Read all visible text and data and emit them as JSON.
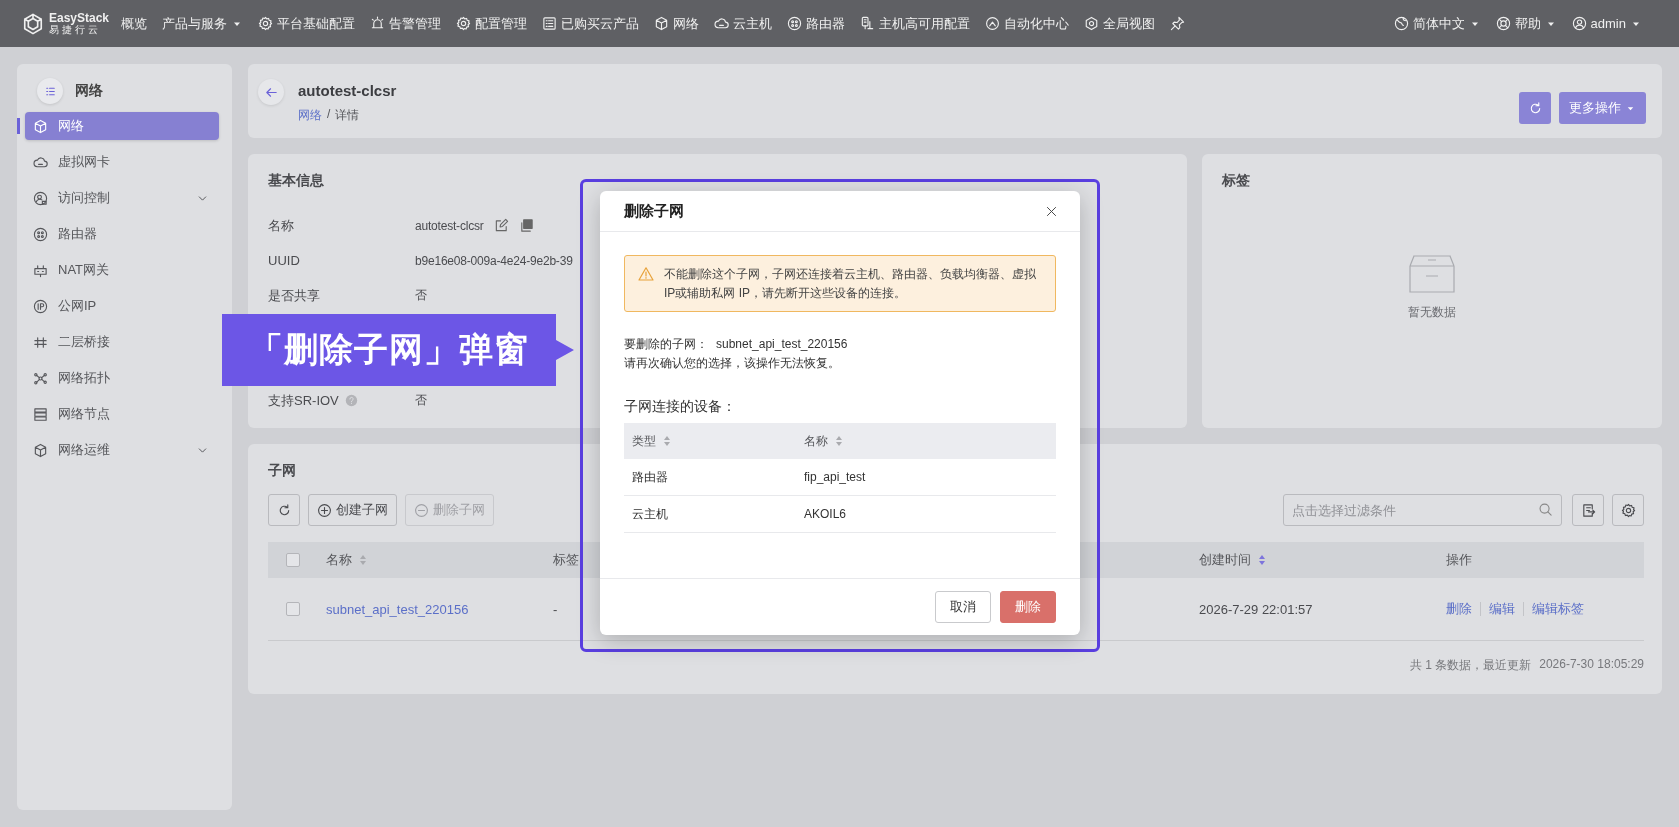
{
  "top_nav": {
    "logo": {
      "name": "EasyStack",
      "tagline": "易捷行云"
    },
    "items": [
      {
        "label": "概览",
        "dropdown": false
      },
      {
        "label": "产品与服务",
        "dropdown": true
      },
      {
        "label": "平台基础配置",
        "dropdown": false
      },
      {
        "label": "告警管理",
        "dropdown": false
      },
      {
        "label": "配置管理",
        "dropdown": false
      },
      {
        "label": "已购买云产品",
        "dropdown": false
      },
      {
        "label": "网络",
        "dropdown": false
      },
      {
        "label": "云主机",
        "dropdown": false
      },
      {
        "label": "路由器",
        "dropdown": false
      },
      {
        "label": "主机高可用配置",
        "dropdown": false
      },
      {
        "label": "自动化中心",
        "dropdown": false
      },
      {
        "label": "全局视图",
        "dropdown": false
      }
    ],
    "right": [
      {
        "label": "简体中文",
        "dropdown": true
      },
      {
        "label": "帮助",
        "dropdown": true
      },
      {
        "label": "admin",
        "dropdown": true
      }
    ]
  },
  "sidebar": {
    "title": "网络",
    "items": [
      {
        "label": "网络",
        "selected": true,
        "expandable": false
      },
      {
        "label": "虚拟网卡",
        "selected": false,
        "expandable": false
      },
      {
        "label": "访问控制",
        "selected": false,
        "expandable": true
      },
      {
        "label": "路由器",
        "selected": false,
        "expandable": false
      },
      {
        "label": "NAT网关",
        "selected": false,
        "expandable": false
      },
      {
        "label": "公网IP",
        "selected": false,
        "expandable": false
      },
      {
        "label": "二层桥接",
        "selected": false,
        "expandable": false
      },
      {
        "label": "网络拓扑",
        "selected": false,
        "expandable": false
      },
      {
        "label": "网络节点",
        "selected": false,
        "expandable": false
      },
      {
        "label": "网络运维",
        "selected": false,
        "expandable": true
      }
    ]
  },
  "header": {
    "title": "autotest-clcsr",
    "breadcrumb": [
      {
        "label": "网络",
        "link": true
      },
      {
        "label": "详情",
        "link": false
      }
    ],
    "breadcrumb_separator": "/",
    "more_button": "更多操作"
  },
  "basic_info": {
    "title": "基本信息",
    "rows": [
      {
        "label": "名称",
        "value": "autotest-clcsr",
        "kind": "editable"
      },
      {
        "label": "UUID",
        "value": "b9e16e08-009a-4e24-9e2b-39",
        "kind": "plain"
      },
      {
        "label": "是否共享",
        "value": "否",
        "kind": "plain"
      },
      {
        "label": "支持SR-IOV",
        "value": "否",
        "kind": "help"
      }
    ]
  },
  "tags_card": {
    "title": "标签",
    "empty_text": "暂无数据"
  },
  "subnets": {
    "title": "子网",
    "buttons": [
      {
        "label": "创建子网",
        "kind": "create",
        "disabled": false
      },
      {
        "label": "删除子网",
        "kind": "delete",
        "disabled": true
      }
    ],
    "filter": {
      "placeholder": "点击选择过滤条件"
    },
    "select_all": {
      "checked": false
    },
    "columns": [
      {
        "label": "名称",
        "sortable": true,
        "sorted": false
      },
      {
        "label": "标签",
        "sortable": false
      },
      {
        "label": "创建时间",
        "sortable": true,
        "sorted": true
      },
      {
        "label": "操作",
        "sortable": false
      }
    ],
    "rows": [
      {
        "checked": false,
        "name": "subnet_api_test_220156",
        "tags": "-",
        "created": "2026-7-29 22:01:57",
        "actions": [
          "删除",
          "编辑",
          "编辑标签"
        ]
      }
    ],
    "summary": "共 1 条数据，最近更新",
    "updated_at": "2026-7-30 18:05:29"
  },
  "callout": {
    "text": "「删除子网」弹窗"
  },
  "dialog": {
    "title": "删除子网",
    "warning": "不能删除这个子网，子网还连接着云主机、路由器、负载均衡器、虚拟IP或辅助私网 IP，请先断开这些设备的连接。",
    "target_label": "要删除的子网：",
    "target_value": "subnet_api_test_220156",
    "confirm_text": "请再次确认您的选择，该操作无法恢复。",
    "devices_title": "子网连接的设备：",
    "columns": [
      {
        "label": "类型",
        "sortable": true
      },
      {
        "label": "名称",
        "sortable": true
      }
    ],
    "rows": [
      [
        "路由器",
        "fip_api_test"
      ],
      [
        "云主机",
        "AKOIL6"
      ]
    ],
    "buttons": [
      {
        "label": "取消",
        "kind": "secondary"
      },
      {
        "label": "删除",
        "kind": "danger"
      }
    ]
  }
}
